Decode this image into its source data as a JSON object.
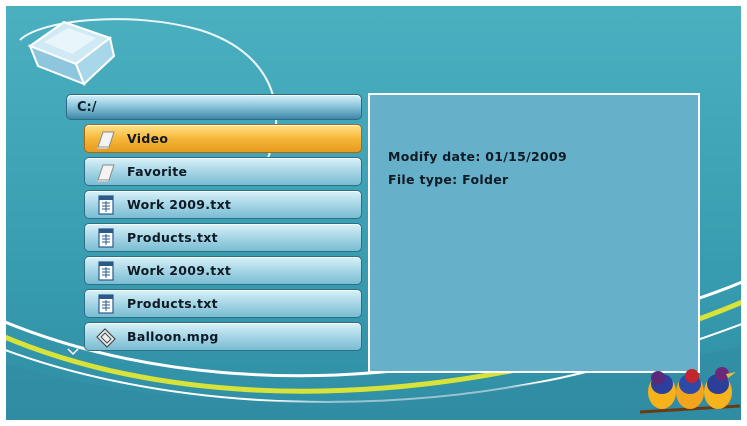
{
  "path": {
    "label": "C:/"
  },
  "files": [
    {
      "name": "Video",
      "icon": "folder-page-icon",
      "selected": true
    },
    {
      "name": "Favorite",
      "icon": "folder-page-icon",
      "selected": false
    },
    {
      "name": "Work 2009.txt",
      "icon": "text-file-icon",
      "selected": false
    },
    {
      "name": "Products.txt",
      "icon": "text-file-icon",
      "selected": false
    },
    {
      "name": "Work 2009.txt",
      "icon": "text-file-icon",
      "selected": false
    },
    {
      "name": "Products.txt",
      "icon": "text-file-icon",
      "selected": false
    },
    {
      "name": "Balloon.mpg",
      "icon": "video-file-icon",
      "selected": false
    }
  ],
  "info": {
    "modify_date": "Modify date: 01/15/2009",
    "file_type": "File type: Folder"
  },
  "colors": {
    "background": "#3a9fb2",
    "selected_row": "#f7b73a",
    "row": "#a6d6e6",
    "panel": "#66b1c9"
  }
}
